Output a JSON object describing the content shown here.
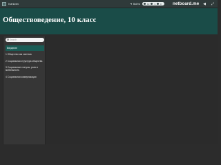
{
  "topbar": {
    "brand_name": "Ivanivan",
    "login_label": "Войти",
    "stats": [
      "10",
      "1",
      "0"
    ],
    "logo_text": "netboard.me"
  },
  "banner": {
    "title": "Обществоведение, 10 класс"
  },
  "sidebar": {
    "search_placeholder": "Search",
    "sections": [
      {
        "label": "Введение",
        "active": true
      },
      {
        "label": "1 Общество как система",
        "active": false
      },
      {
        "label": "2 Социальная структура общества",
        "active": false
      },
      {
        "label": "3 Социальные статусы, роли и мобильность",
        "active": false
      },
      {
        "label": "4 Социальная коммуникация",
        "active": false
      }
    ]
  },
  "colors": {
    "topbar": "#2f3a3a",
    "banner": "#1a4c48",
    "active_section": "#1a5c55",
    "sidebar": "#363636",
    "main": "#2b2b2b"
  }
}
